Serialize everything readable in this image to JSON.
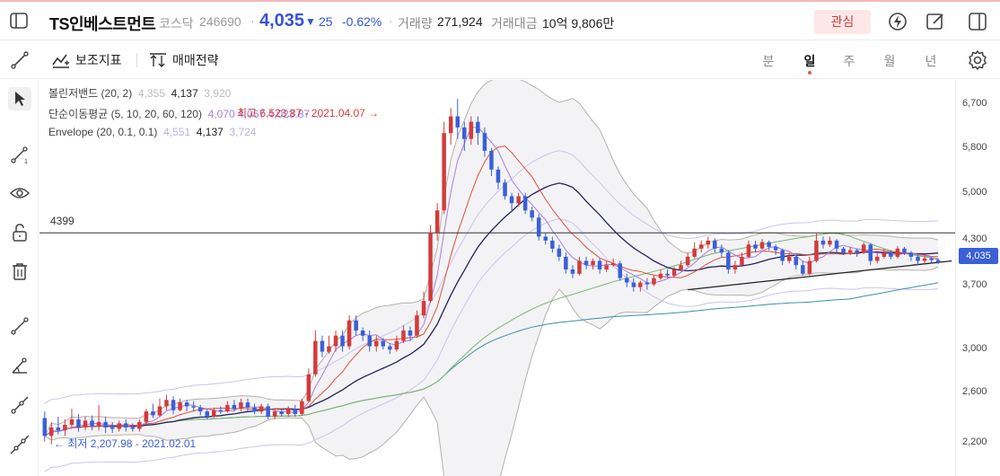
{
  "header": {
    "stock_name": "TS인베스트먼트",
    "market": "코스닥",
    "code": "246690",
    "dot": "·",
    "price": "4,035",
    "change_arrow": "▼",
    "change": "25",
    "change_pct": "-0.62%",
    "volume_label": "거래량",
    "volume": "271,924",
    "amount_label": "거래대금",
    "amount": "10억 9,806만",
    "watch_button": "관심",
    "accent_down": "#3552d8",
    "accent_up": "#d33b3b"
  },
  "toolbar": {
    "indicators_label": "보조지표",
    "strategy_label": "매매전략",
    "periods": [
      "분",
      "일",
      "주",
      "월",
      "년"
    ],
    "active_period": "일"
  },
  "sidebar": {
    "tools": [
      "cursor-icon",
      "line-tool-icon",
      "eye-icon",
      "unlock-icon",
      "trash-icon",
      "trendline-icon",
      "angle-line-icon",
      "ray-line-icon",
      "extended-line-icon"
    ]
  },
  "chart": {
    "legend": {
      "bollinger_name": "볼린저밴드 (20, 2)",
      "bollinger_upper": "4,355",
      "bollinger_mid": "4,137",
      "bollinger_lower": "3,920",
      "sma_name": "단순이동평균 (5, 10, 20, 60, 120)",
      "sma_values": "4,070 4,067 4,023.87 ...",
      "envelope_name": "Envelope (20, 0.1, 0.1)",
      "envelope_upper": "4,551",
      "envelope_mid": "4,137",
      "envelope_lower": "3,724"
    },
    "high_note": "최고 6,523.87 - 2021.04.07 →",
    "low_note": "← 최저 2,207.98 - 2021.02.01",
    "hline_label": "4399",
    "current_price_tag": "4,035",
    "y_ticks": [
      "6,700",
      "5,800",
      "5,000",
      "4,300",
      "3,700",
      "3,000",
      "2,600",
      "2,200"
    ],
    "colors": {
      "up": "#d33b3b",
      "down": "#3a5fd8",
      "band": "#b9b0a6",
      "ma5": "#a77de0",
      "ma10": "#e0503a",
      "ma20": "#23215e",
      "ma60": "#7ab56f",
      "ma120": "#3b8fa8"
    }
  },
  "chart_data": {
    "type": "candlestick",
    "y_scale": "log",
    "ylim": [
      2150,
      6900
    ],
    "x_count": 135,
    "candles": [
      [
        2550,
        2420,
        2600,
        2380
      ],
      [
        2420,
        2480,
        2520,
        2360
      ],
      [
        2480,
        2460,
        2560,
        2430
      ],
      [
        2460,
        2500,
        2540,
        2420
      ],
      [
        2500,
        2540,
        2620,
        2470
      ],
      [
        2540,
        2480,
        2580,
        2450
      ],
      [
        2480,
        2530,
        2560,
        2460
      ],
      [
        2530,
        2490,
        2570,
        2460
      ],
      [
        2490,
        2520,
        2650,
        2460
      ],
      [
        2520,
        2480,
        2560,
        2440
      ],
      [
        2480,
        2470,
        2520,
        2440
      ],
      [
        2470,
        2510,
        2530,
        2450
      ],
      [
        2510,
        2480,
        2540,
        2450
      ],
      [
        2480,
        2470,
        2510,
        2450
      ],
      [
        2470,
        2520,
        2540,
        2450
      ],
      [
        2520,
        2600,
        2620,
        2500
      ],
      [
        2600,
        2570,
        2660,
        2550
      ],
      [
        2570,
        2640,
        2700,
        2560
      ],
      [
        2640,
        2690,
        2730,
        2610
      ],
      [
        2690,
        2610,
        2720,
        2580
      ],
      [
        2610,
        2670,
        2700,
        2600
      ],
      [
        2670,
        2640,
        2690,
        2600
      ],
      [
        2640,
        2630,
        2680,
        2600
      ],
      [
        2630,
        2600,
        2650,
        2570
      ],
      [
        2600,
        2560,
        2620,
        2540
      ],
      [
        2560,
        2610,
        2630,
        2550
      ],
      [
        2610,
        2600,
        2640,
        2580
      ],
      [
        2600,
        2650,
        2680,
        2590
      ],
      [
        2650,
        2620,
        2690,
        2600
      ],
      [
        2620,
        2670,
        2700,
        2600
      ],
      [
        2670,
        2630,
        2700,
        2600
      ],
      [
        2630,
        2600,
        2660,
        2580
      ],
      [
        2600,
        2640,
        2660,
        2580
      ],
      [
        2640,
        2560,
        2660,
        2540
      ],
      [
        2560,
        2600,
        2620,
        2540
      ],
      [
        2600,
        2580,
        2620,
        2560
      ],
      [
        2580,
        2620,
        2640,
        2560
      ],
      [
        2620,
        2580,
        2650,
        2560
      ],
      [
        2580,
        2680,
        2700,
        2570
      ],
      [
        2680,
        2900,
        2950,
        2670
      ],
      [
        2900,
        3200,
        3300,
        2880
      ],
      [
        3200,
        3100,
        3250,
        3050
      ],
      [
        3100,
        3150,
        3250,
        3080
      ],
      [
        3150,
        3250,
        3300,
        3100
      ],
      [
        3250,
        3150,
        3300,
        3100
      ],
      [
        3150,
        3400,
        3450,
        3120
      ],
      [
        3400,
        3300,
        3450,
        3250
      ],
      [
        3300,
        3250,
        3330,
        3200
      ],
      [
        3250,
        3150,
        3300,
        3100
      ],
      [
        3150,
        3200,
        3250,
        3100
      ],
      [
        3200,
        3150,
        3230,
        3120
      ],
      [
        3150,
        3120,
        3180,
        3080
      ],
      [
        3120,
        3200,
        3250,
        3100
      ],
      [
        3200,
        3300,
        3350,
        3180
      ],
      [
        3300,
        3250,
        3340,
        3200
      ],
      [
        3250,
        3450,
        3500,
        3230
      ],
      [
        3450,
        3600,
        3700,
        3420
      ],
      [
        3600,
        4400,
        4500,
        3580
      ],
      [
        4400,
        4700,
        4800,
        4300
      ],
      [
        4700,
        5900,
        6100,
        4650
      ],
      [
        5900,
        6200,
        6350,
        5700
      ],
      [
        6200,
        6000,
        6523,
        5800
      ],
      [
        6000,
        5800,
        6100,
        5600
      ],
      [
        5800,
        6100,
        6200,
        5700
      ],
      [
        6100,
        5900,
        6200,
        5700
      ],
      [
        5900,
        5600,
        6000,
        5500
      ],
      [
        5600,
        5300,
        5650,
        5200
      ],
      [
        5300,
        5100,
        5350,
        5000
      ],
      [
        5100,
        4900,
        5150,
        4850
      ],
      [
        4900,
        4800,
        4950,
        4700
      ],
      [
        4800,
        4900,
        4950,
        4750
      ],
      [
        4900,
        4700,
        4950,
        4650
      ],
      [
        4700,
        4600,
        4750,
        4550
      ],
      [
        4600,
        4350,
        4650,
        4300
      ],
      [
        4350,
        4300,
        4400,
        4250
      ],
      [
        4300,
        4200,
        4350,
        4150
      ],
      [
        4200,
        4100,
        4250,
        4050
      ],
      [
        4100,
        3950,
        4150,
        3900
      ],
      [
        3950,
        3900,
        4000,
        3850
      ],
      [
        3900,
        4050,
        4100,
        3880
      ],
      [
        4050,
        4000,
        4100,
        3950
      ],
      [
        4000,
        4050,
        4080,
        3950
      ],
      [
        4050,
        3950,
        4080,
        3900
      ],
      [
        3950,
        4000,
        4050,
        3920
      ],
      [
        4000,
        4020,
        4080,
        3980
      ],
      [
        4020,
        3850,
        4050,
        3820
      ],
      [
        3850,
        3800,
        3900,
        3750
      ],
      [
        3800,
        3750,
        3850,
        3700
      ],
      [
        3750,
        3800,
        3820,
        3700
      ],
      [
        3800,
        3780,
        3850,
        3720
      ],
      [
        3780,
        3850,
        3880,
        3760
      ],
      [
        3850,
        3900,
        3950,
        3830
      ],
      [
        3900,
        3880,
        3950,
        3850
      ],
      [
        3880,
        3950,
        3980,
        3860
      ],
      [
        3950,
        4000,
        4050,
        3930
      ],
      [
        4000,
        4100,
        4150,
        3980
      ],
      [
        4100,
        4200,
        4280,
        4080
      ],
      [
        4200,
        4250,
        4300,
        4150
      ],
      [
        4250,
        4300,
        4350,
        4200
      ],
      [
        4300,
        4200,
        4330,
        4150
      ],
      [
        4200,
        4150,
        4250,
        4100
      ],
      [
        4150,
        3950,
        4180,
        3900
      ],
      [
        3950,
        4000,
        4050,
        3900
      ],
      [
        4000,
        4100,
        4150,
        3980
      ],
      [
        4100,
        4250,
        4300,
        4080
      ],
      [
        4250,
        4200,
        4300,
        4150
      ],
      [
        4200,
        4280,
        4320,
        4180
      ],
      [
        4280,
        4220,
        4300,
        4180
      ],
      [
        4220,
        4180,
        4250,
        4120
      ],
      [
        4180,
        4050,
        4200,
        4000
      ],
      [
        4050,
        4100,
        4150,
        4020
      ],
      [
        4100,
        4000,
        4120,
        3950
      ],
      [
        4000,
        3900,
        4050,
        3880
      ],
      [
        3900,
        4050,
        4100,
        3880
      ],
      [
        4050,
        4300,
        4400,
        4030
      ],
      [
        4300,
        4250,
        4350,
        4200
      ],
      [
        4250,
        4300,
        4350,
        4220
      ],
      [
        4300,
        4200,
        4320,
        4150
      ],
      [
        4200,
        4150,
        4220,
        4120
      ],
      [
        4150,
        4180,
        4220,
        4120
      ],
      [
        4180,
        4150,
        4200,
        4100
      ],
      [
        4150,
        4250,
        4280,
        4130
      ],
      [
        4250,
        4050,
        4270,
        4000
      ],
      [
        4050,
        4100,
        4150,
        4020
      ],
      [
        4100,
        4150,
        4200,
        4080
      ],
      [
        4150,
        4100,
        4180,
        4070
      ],
      [
        4100,
        4200,
        4230,
        4080
      ],
      [
        4200,
        4150,
        4220,
        4120
      ],
      [
        4150,
        4100,
        4170,
        4050
      ],
      [
        4100,
        4050,
        4120,
        4000
      ],
      [
        4050,
        4080,
        4120,
        4020
      ],
      [
        4080,
        4060,
        4100,
        4030
      ],
      [
        4060,
        4035,
        4080,
        4010
      ]
    ],
    "horizontal_line": 4399,
    "trend_line": [
      [
        95,
        3720
      ],
      [
        134,
        4050
      ]
    ]
  }
}
